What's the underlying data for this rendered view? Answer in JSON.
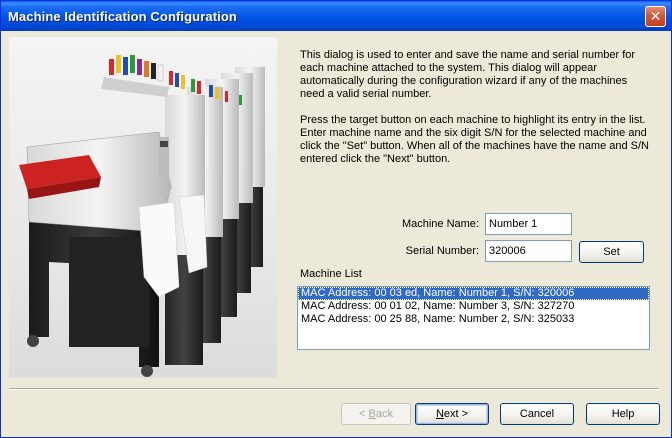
{
  "window": {
    "title": "Machine Identification Configuration",
    "close_glyph": "✕"
  },
  "description": {
    "paragraph1": "This dialog is used to enter and save the name and serial number for each machine attached to the system. This dialog will appear automatically during the configuration wizard if any of the machines need a valid serial number.",
    "paragraph2": "Press the target button on each machine to highlight its entry in the list. Enter machine name and the six digit S/N for the selected machine and click the \"Set\" button. When all of the machines have the name and S/N entered click the \"Next\" button."
  },
  "form": {
    "machine_name_label": "Machine Name:",
    "machine_name_value": "Number 1",
    "serial_number_label": "Serial Number:",
    "serial_number_value": "320006",
    "set_button": "Set"
  },
  "machine_list": {
    "label": "Machine List",
    "items": [
      {
        "text": "MAC Address: 00 03 ed, Name: Number 1, S/N: 320006",
        "selected": true
      },
      {
        "text": "MAC Address: 00 01 02, Name: Number 3, S/N: 327270",
        "selected": false
      },
      {
        "text": "MAC Address: 00 25 88, Name: Number 2, S/N: 325033",
        "selected": false
      }
    ]
  },
  "buttons": {
    "back_prefix": "< ",
    "back_accel": "B",
    "back_rest": "ack",
    "next_accel": "N",
    "next_rest": "ext >",
    "cancel": "Cancel",
    "help": "Help"
  },
  "colors": {
    "titlebar": "#0054e3",
    "dialog_bg": "#ece9d8",
    "selection": "#316ac5"
  },
  "image": {
    "icon": "embroidery-machines-photo"
  }
}
